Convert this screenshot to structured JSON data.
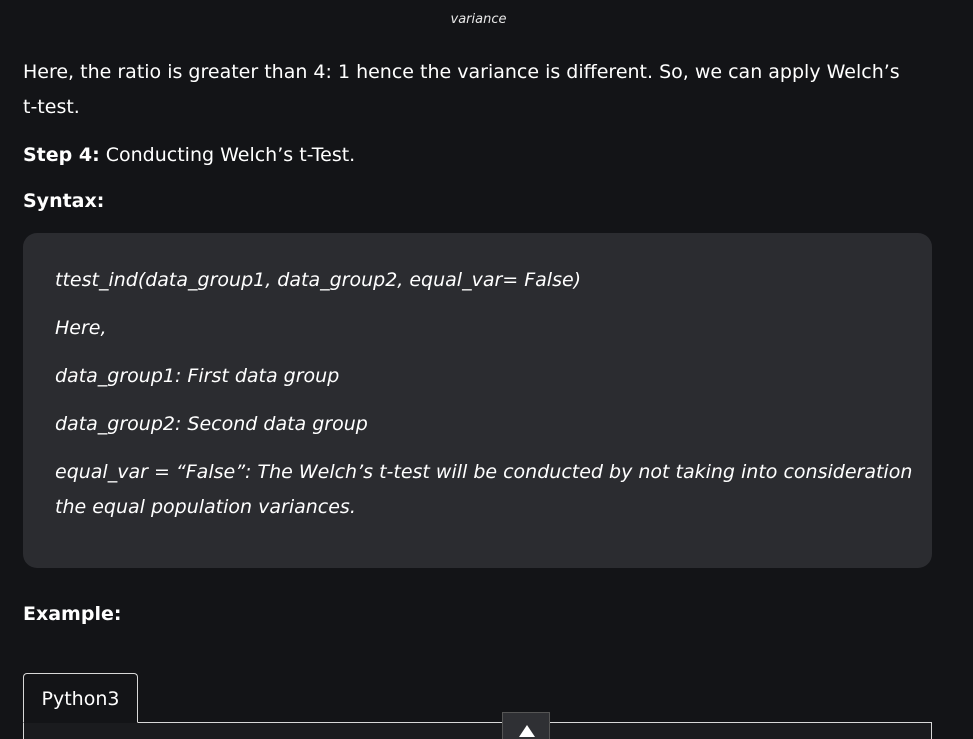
{
  "caption": "variance",
  "intro": "Here, the ratio is greater than 4: 1 hence the variance is different. So, we can apply Welch’s t-test.",
  "step": {
    "label": "Step 4:",
    "text": " Conducting Welch’s t-Test."
  },
  "syntax_heading": "Syntax:",
  "syntax": {
    "call": "ttest_ind(data_group1, data_group2, equal_var= False)",
    "here": "Here,",
    "arg1": "data_group1: First data group",
    "arg2": "data_group2: Second data group",
    "arg3": "equal_var = “False”: The Welch’s t-test will be conducted by not taking into consideration the equal population variances."
  },
  "example_heading": "Example:",
  "code_tab": "Python3",
  "icons": {
    "scroll_top": "chevron-up-icon"
  }
}
